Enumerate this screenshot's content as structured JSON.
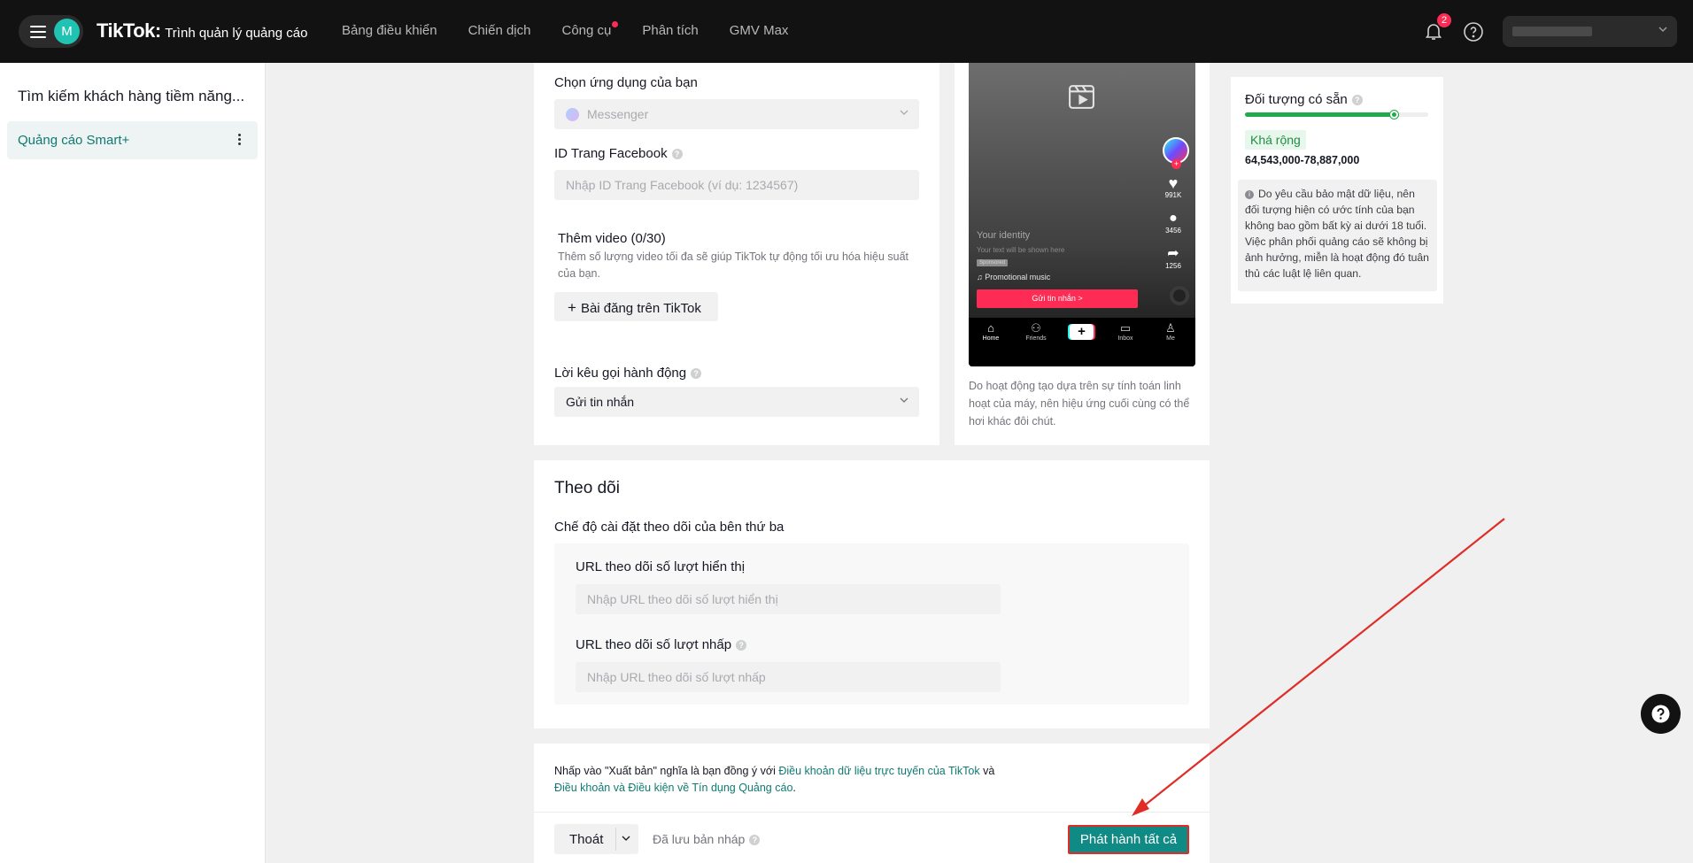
{
  "header": {
    "avatar_letter": "M",
    "brand_logo": "TikTok",
    "brand_sep": ":",
    "brand_subtitle": "Trình quản lý quảng cáo",
    "nav": [
      "Bảng điều khiển",
      "Chiến dịch",
      "Công cụ",
      "Phân tích",
      "GMV Max"
    ],
    "notifications_count": "2",
    "icons": {
      "menu": "hamburger-icon",
      "bell": "bell-icon",
      "help": "help-circle-icon",
      "account_chevron": "chevron-down-icon"
    }
  },
  "sidebar": {
    "title": "Tìm kiếm khách hàng tiềm năng...",
    "items": [
      {
        "label": "Quảng cáo Smart+"
      }
    ]
  },
  "form": {
    "app_label": "Chọn ứng dụng của bạn",
    "app_value": "Messenger",
    "fb_id_label": "ID Trang Facebook",
    "fb_id_placeholder": "Nhập ID Trang Facebook (ví dụ: 1234567)",
    "video_label": "Thêm video (0/30)",
    "video_help": "Thêm số lượng video tối đa sẽ giúp TikTok tự động tối ưu hóa hiệu suất của bạn.",
    "video_button": "Bài đăng trên TikTok",
    "cta_label": "Lời kêu gọi hành động",
    "cta_value": "Gửi tin nhắn"
  },
  "preview": {
    "likes": "991K",
    "comments": "3456",
    "shares": "1256",
    "identity": "Your identity",
    "text_placeholder": "Your text will be shown here",
    "sponsored": "Sponsored",
    "music": "♫ Promotional music",
    "cta": "Gửi tin nhắn >",
    "nav": [
      "Home",
      "Friends",
      "Inbox",
      "Me"
    ],
    "note": "Do hoạt động tạo dựa trên sự tính toán linh hoạt của máy, nên hiệu ứng cuối cùng có thể hơi khác đôi chút."
  },
  "tracking": {
    "title": "Theo dõi",
    "mode_label": "Chế độ cài đặt theo dõi của bên thứ ba",
    "impression_label": "URL theo dõi số lượt hiển thị",
    "impression_placeholder": "Nhập URL theo dõi số lượt hiển thị",
    "click_label": "URL theo dõi số lượt nhấp",
    "click_placeholder": "Nhập URL theo dõi số lượt nhấp"
  },
  "publish": {
    "terms_prefix": "Nhấp vào \"Xuất bản\" nghĩa là bạn đồng ý với ",
    "terms_link1": "Điều khoản dữ liệu trực tuyến của TikTok",
    "terms_and": " và",
    "terms_link2": "Điều khoản và Điều kiện về Tín dụng Quảng cáo",
    "terms_end": ".",
    "exit_label": "Thoát",
    "draft_status": "Đã lưu bản nháp",
    "publish_label": "Phát hành tất cả"
  },
  "audience": {
    "title": "Đối tượng có sẵn",
    "level": 0.81,
    "tag": "Khá rộng",
    "range": "64,543,000-78,887,000",
    "note": "Do yêu cầu bảo mật dữ liệu, nên đối tượng hiện có ước tính của bạn không bao gồm bất kỳ ai dưới 18 tuổi. Việc phân phối quảng cáo sẽ không bị ảnh hưởng, miễn là hoạt động đó tuân thủ các luật lệ liên quan."
  },
  "colors": {
    "accent": "#0f8a85",
    "highlight": "#e02c26",
    "topbar": "#121212",
    "audience_bar": "#22a94b"
  }
}
